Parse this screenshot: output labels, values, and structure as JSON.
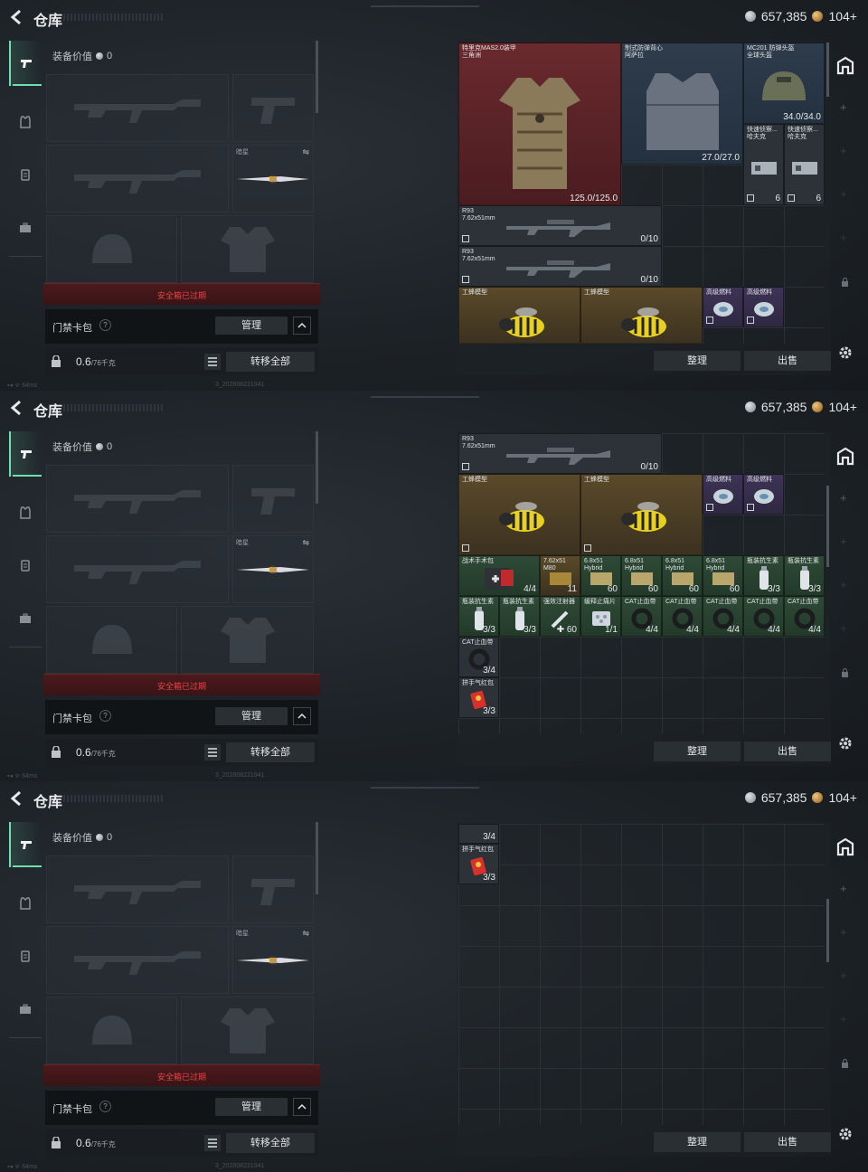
{
  "header": {
    "title": "仓库",
    "currency_silver": "657,385",
    "currency_gold": "104+"
  },
  "sidebar": {
    "tabs": [
      "pistol-tab",
      "vest-tab",
      "backpack-tab",
      "case-tab"
    ]
  },
  "equip": {
    "value_label": "装备价值",
    "value": "0",
    "melee_label": "暗星",
    "safebox_text": "安全箱已过期",
    "card_label": "门禁卡包",
    "help": "?",
    "manage_label": "管理",
    "weight_value": "0.6",
    "weight_unit": "/76千克",
    "transfer_label": "转移全部"
  },
  "stash": {
    "sort_label": "整理",
    "sell_label": "出售"
  },
  "status": {
    "ping": "64ms",
    "build": "3_202608221941"
  },
  "items": {
    "armor": {
      "name": "特里克MAS2.0装甲",
      "sub": "三角洲",
      "durability": "125.0/125.0"
    },
    "vest": {
      "name": "制式防弹背心",
      "sub": "阿萨拉",
      "durability": "27.0/27.0"
    },
    "helmet": {
      "name": "MC201 防弹头盔",
      "sub": "全球头盔",
      "durability": "34.0/34.0"
    },
    "recon1": {
      "name": "快速侦察...",
      "sub": "哈夫克",
      "count": "6"
    },
    "recon2": {
      "name": "快速侦察...",
      "sub": "哈夫克",
      "count": "6"
    },
    "rifle1": {
      "name": "R93",
      "sub": "7.62x51mm",
      "ammo": "0/10"
    },
    "rifle2": {
      "name": "R93",
      "sub": "7.62x51mm",
      "ammo": "0/10"
    },
    "wasp1": {
      "name": "工蜂模型"
    },
    "wasp2": {
      "name": "工蜂模型"
    },
    "fuel1": {
      "name": "高级燃料"
    },
    "fuel2": {
      "name": "高级燃料"
    },
    "medkit": {
      "name": "战术手术包",
      "count": "4/4"
    },
    "ammo762": {
      "name": "7.62x51",
      "sub": "M80",
      "count": "11"
    },
    "ammo68a": {
      "name": "6.8x51",
      "sub": "Hybrid",
      "count": "60"
    },
    "ammo68b": {
      "name": "6.8x51",
      "sub": "Hybrid",
      "count": "60"
    },
    "ammo68c": {
      "name": "6.8x51",
      "sub": "Hybrid",
      "count": "60"
    },
    "ammo68d": {
      "name": "6.8x51",
      "sub": "Hybrid",
      "count": "60"
    },
    "spray1": {
      "name": "瓶装抗生素",
      "count": "3/3"
    },
    "spray2": {
      "name": "瓶装抗生素",
      "count": "3/3"
    },
    "spray3": {
      "name": "瓶装抗生素",
      "count": "3/3"
    },
    "spray4": {
      "name": "瓶装抗生素",
      "count": "3/3"
    },
    "injector": {
      "name": "强效注射器",
      "count": "60"
    },
    "pills": {
      "name": "缓释止痛片",
      "count": "1/1"
    },
    "tourniquet1": {
      "name": "CAT止血带",
      "count": "4/4"
    },
    "tourniquet2": {
      "name": "CAT止血带",
      "count": "4/4"
    },
    "tourniquet3": {
      "name": "CAT止血带",
      "count": "4/4"
    },
    "tourniquet4": {
      "name": "CAT止血带",
      "count": "4/4"
    },
    "tourniquet5": {
      "name": "CAT止血带",
      "count": "4/4"
    },
    "tourniquet6": {
      "name": "CAT止血带",
      "count": "3/4"
    },
    "redpack": {
      "name": "拼手气红包",
      "count": "3/3"
    }
  },
  "colors": {
    "accent": "#6ee0b0",
    "danger": "#e04848",
    "bg": "#1a1f24"
  }
}
